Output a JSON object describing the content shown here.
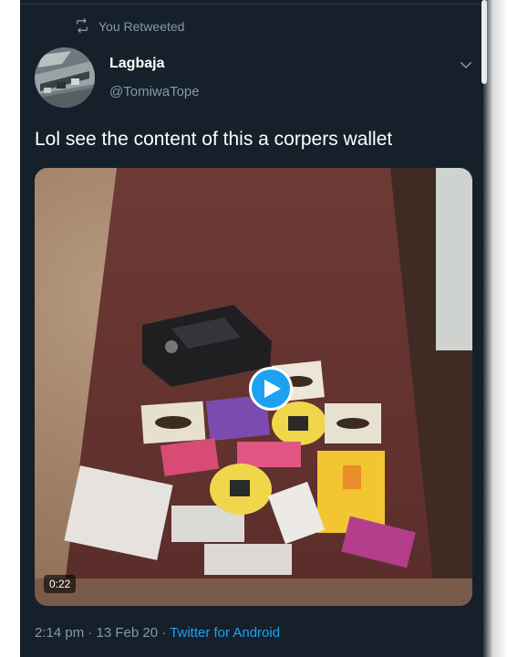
{
  "retweet": {
    "label": "You Retweeted",
    "icon": "retweet-icon"
  },
  "author": {
    "name": "Lagbaja",
    "handle": "@TomiwaTope"
  },
  "tweet": {
    "text": "Lol see the content of this a corpers wallet"
  },
  "media": {
    "duration": "0:22",
    "play_icon": "play-icon"
  },
  "meta": {
    "time": "2:14 pm",
    "separator1": " · ",
    "date": "13 Feb 20",
    "separator2": " · ",
    "source": "Twitter for Android"
  },
  "colors": {
    "background": "#15202b",
    "accent": "#1da1f2",
    "secondary_text": "#8899a6",
    "primary_text": "#ffffff"
  }
}
